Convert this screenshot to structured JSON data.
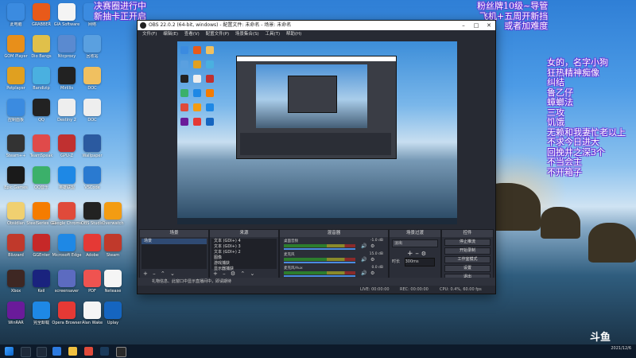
{
  "desktop": {
    "icons": [
      {
        "label": "此电脑",
        "color": "#3b8be0"
      },
      {
        "label": "GRABBER",
        "color": "#e85a1a"
      },
      {
        "label": "GIA Software",
        "color": "#f4f4f4"
      },
      {
        "label": "网络",
        "color": "#3b8be0"
      },
      {
        "label": "GOM Player",
        "color": "#e88f1a"
      },
      {
        "label": "Dio Bangs",
        "color": "#e0c04a"
      },
      {
        "label": "Ntcproxy",
        "color": "#5a8ad0"
      },
      {
        "label": "回收站",
        "color": "#5aa0e0"
      },
      {
        "label": "Potplayer",
        "color": "#e0a020"
      },
      {
        "label": "Bandizip",
        "color": "#4ab0e0"
      },
      {
        "label": "Mirillis",
        "color": "#222"
      },
      {
        "label": "DOC",
        "color": "#f0c060"
      },
      {
        "label": "控制面板",
        "color": "#3b8be0"
      },
      {
        "label": "QQ",
        "color": "#222"
      },
      {
        "label": "Destiny 2",
        "color": "#eee"
      },
      {
        "label": "DOC",
        "color": "#eee"
      },
      {
        "label": "Steam++",
        "color": "#333"
      },
      {
        "label": "TeamSpeak",
        "color": "#e04a4a"
      },
      {
        "label": "GPU-Z",
        "color": "#c03030"
      },
      {
        "label": "Wallpaper",
        "color": "#2b5aa0"
      },
      {
        "label": "Epic Games",
        "color": "#1a1a1a"
      },
      {
        "label": "QQ音乐",
        "color": "#3bb06a"
      },
      {
        "label": "英雄联盟",
        "color": "#1e88e5"
      },
      {
        "label": "VSCode",
        "color": "#2a7ad0"
      },
      {
        "label": "Obsidian",
        "color": "#f0d070"
      },
      {
        "label": "SteelSeries GG",
        "color": "#f57c00"
      },
      {
        "label": "Google Chrome",
        "color": "#e04a3a"
      },
      {
        "label": "OBS Studio",
        "color": "#222"
      },
      {
        "label": "Overwatch",
        "color": "#f39c12"
      },
      {
        "label": "Blizzard",
        "color": "#c0392b"
      },
      {
        "label": "GGEnter",
        "color": "#c62828"
      },
      {
        "label": "Microsoft Edge",
        "color": "#1e88e5"
      },
      {
        "label": "Adobe",
        "color": "#e53935"
      },
      {
        "label": "Steam",
        "color": "#c0392b"
      },
      {
        "label": "Xbox",
        "color": "#3e2723"
      },
      {
        "label": "Keil",
        "color": "#1a237e"
      },
      {
        "label": "screensaver",
        "color": "#5c6bc0"
      },
      {
        "label": "PDF",
        "color": "#ef5350"
      },
      {
        "label": "Netease",
        "color": "#f5f5f5"
      },
      {
        "label": "WinRAR",
        "color": "#6a1b9a"
      },
      {
        "label": "完全卸载",
        "color": "#1e88e5"
      },
      {
        "label": "Opera Browser",
        "color": "#e53935"
      },
      {
        "label": "Alan Wake",
        "color": "#f5f5f5"
      },
      {
        "label": "Uplay",
        "color": "#1565c0"
      },
      {
        "label": "Steam",
        "color": "#1a3a5a"
      }
    ],
    "overlay_left_lines": [
      "决赛圈进行中",
      "新抽卡正开启"
    ],
    "overlay_right_top_lines": [
      "粉丝牌10级~导管",
      "飞机+五周开新挡",
      "或者加难度"
    ],
    "overlay_right_lines": [
      "女的，名字小狗",
      "狂热精神痴像",
      "纠结",
      "鲁乙仔",
      "蟑螂法",
      "三攻",
      "饥饿",
      "无赖和我妻忙老以上",
      "不求今日进大",
      "回挽井之深3个",
      "不当会主",
      "不开箱子"
    ],
    "watermark": "斗鱼"
  },
  "obs": {
    "title": "OBS 22.0.2 (64-bit, windows) - 配置文件: 未命名 - 场景: 未命名",
    "menu": [
      "文件(F)",
      "编辑(E)",
      "查看(V)",
      "配置文件(P)",
      "场景集合(S)",
      "工具(T)",
      "帮助(H)"
    ],
    "panels": {
      "scenes": {
        "title": "场景",
        "items": [
          "场景"
        ]
      },
      "sources": {
        "title": "来源",
        "items": [
          "文本 (GDI+) 4",
          "文本 (GDI+) 3",
          "文本 (GDI+) 2",
          "图像",
          "游戏捕获",
          "显示器捕获"
        ]
      },
      "mixer": {
        "title": "混音器",
        "channels": [
          {
            "name": "桌面音频",
            "db": "-1.0 dB"
          },
          {
            "name": "麦克风",
            "db": "15.0 dB"
          },
          {
            "name": "麦克风/Aux",
            "db": "0.0 dB"
          }
        ]
      },
      "transitions": {
        "title": "场景过渡",
        "type": "淡出",
        "duration_label": "时长",
        "duration": "300ms"
      },
      "controls": {
        "title": "控件",
        "buttons": [
          "停止推流",
          "开始录制",
          "工作室模式",
          "设置",
          "退出"
        ]
      }
    },
    "banner": "礼物信息、此窗口中显示直播间中，即请期待",
    "status": {
      "live": "LIVE: 00:00:00",
      "rec": "REC: 00:00:00",
      "cpu": "CPU: 0.4%, 60.00 fps"
    }
  },
  "taskbar": {
    "time": "2021/12/6"
  }
}
